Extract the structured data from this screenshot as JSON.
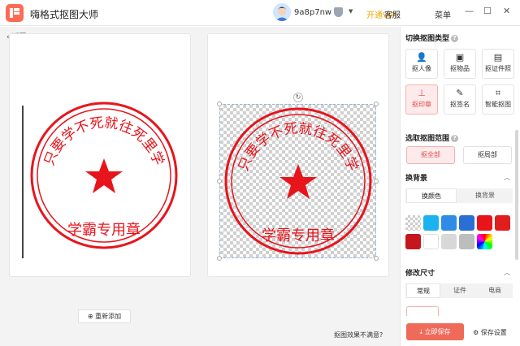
{
  "titlebar": {
    "app_title": "嗨格式抠图大师",
    "username": "9a8p7nw",
    "vip_label": "开通VIP",
    "service_label": "客服",
    "menu_label": "菜单",
    "minimize": "—",
    "maximize": "☐",
    "close": "✕"
  },
  "nav": {
    "back_label": "返回"
  },
  "left": {
    "readd_label": "重新添加",
    "feedback_label": "抠图效果不满意?"
  },
  "stamp": {
    "arc_text": "只要学不死就往死里学",
    "bottom_text": "学霸专用章",
    "color": "#e8141c"
  },
  "panel": {
    "switch_type_title": "切换抠图类型",
    "tools": [
      {
        "label": "抠人像",
        "icon": "person-icon"
      },
      {
        "label": "抠物品",
        "icon": "box-icon"
      },
      {
        "label": "抠证件照",
        "icon": "id-card-icon"
      },
      {
        "label": "抠印章",
        "icon": "stamp-icon"
      },
      {
        "label": "抠签名",
        "icon": "pen-icon"
      },
      {
        "label": "智能抠图",
        "icon": "ai-icon"
      }
    ],
    "scope_title": "选取抠图范围",
    "scope_all": "抠全部",
    "scope_part": "抠局部",
    "bg_title": "换背景",
    "bg_color_tab": "换颜色",
    "bg_image_tab": "换背景",
    "swatches": [
      "transparent",
      "#1ab3ef",
      "#2e8be6",
      "#2a6fd6",
      "#e8141c",
      "#e01e1e",
      "#c4161c",
      "#ffffff",
      "#d8d8d8",
      "#bdbdbd",
      "gradient"
    ],
    "size_title": "修改尺寸",
    "size_tabs": [
      "常规",
      "证件",
      "电商"
    ],
    "save_label": "立即保存",
    "save_settings_label": "保存设置"
  }
}
